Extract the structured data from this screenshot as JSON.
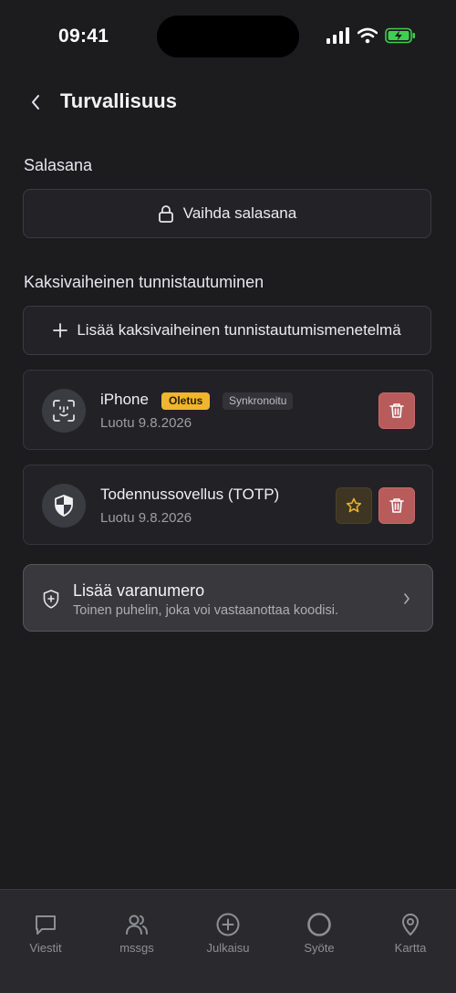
{
  "status_bar": {
    "time": "09:41"
  },
  "header": {
    "title": "Turvallisuus"
  },
  "password_section": {
    "title": "Salasana",
    "change_label": "Vaihda salasana"
  },
  "two_factor_section": {
    "title": "Kaksivaiheinen tunnistautuminen",
    "add_label": "Lisää kaksivaiheinen tunnistautumismenetelmä",
    "methods": [
      {
        "name": "iPhone",
        "default_badge": "Oletus",
        "sync_badge": "Synkronoitu",
        "created": "Luotu 9.8.2026",
        "icon": "face-id-icon"
      },
      {
        "name": "Todennussovellus (TOTP)",
        "created": "Luotu 9.8.2026",
        "icon": "shield-icon"
      }
    ]
  },
  "backup": {
    "title": "Lisää varanumero",
    "subtitle": "Toinen puhelin, joka voi vastaanottaa koodisi."
  },
  "tabbar": {
    "tabs": [
      {
        "label": "Viestit",
        "icon": "chat-icon"
      },
      {
        "label": "mssgs",
        "icon": "users-icon"
      },
      {
        "label": "Julkaisu",
        "icon": "plus-circle-icon"
      },
      {
        "label": "Syöte",
        "icon": "circle-icon"
      },
      {
        "label": "Kartta",
        "icon": "map-pin-icon"
      }
    ]
  },
  "colors": {
    "background": "#1c1c1f",
    "badge_default": "#f0b62e",
    "delete_button": "#b75b5b",
    "star": "#e7b02f"
  }
}
